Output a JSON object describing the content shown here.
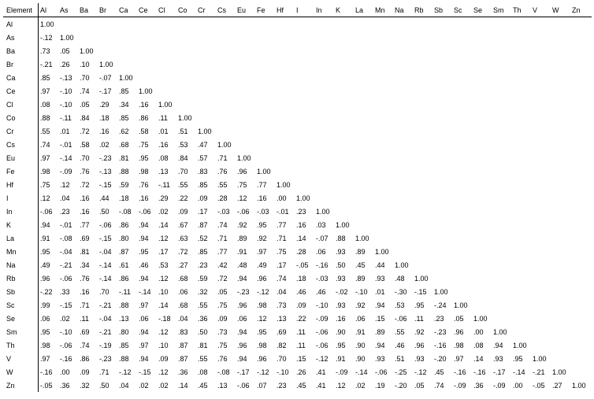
{
  "chart_data": {
    "type": "table",
    "title": "",
    "row_label": "Element",
    "elements": [
      "Al",
      "As",
      "Ba",
      "Br",
      "Ca",
      "Ce",
      "Cl",
      "Co",
      "Cr",
      "Cs",
      "Eu",
      "Fe",
      "Hf",
      "I",
      "In",
      "K",
      "La",
      "Mn",
      "Na",
      "Rb",
      "Sb",
      "Sc",
      "Se",
      "Sm",
      "Th",
      "V",
      "W",
      "Zn"
    ],
    "matrix": [
      [
        1.0
      ],
      [
        -0.12,
        1.0
      ],
      [
        0.73,
        0.05,
        1.0
      ],
      [
        -0.21,
        0.26,
        0.1,
        1.0
      ],
      [
        0.85,
        -0.13,
        0.7,
        -0.07,
        1.0
      ],
      [
        0.97,
        -0.1,
        0.74,
        -0.17,
        0.85,
        1.0
      ],
      [
        0.08,
        -0.1,
        0.05,
        0.29,
        0.34,
        0.16,
        1.0
      ],
      [
        0.88,
        -0.11,
        0.84,
        0.18,
        0.85,
        0.86,
        0.11,
        1.0
      ],
      [
        0.55,
        0.01,
        0.72,
        0.16,
        0.62,
        0.58,
        0.01,
        0.51,
        1.0
      ],
      [
        0.74,
        -0.01,
        0.58,
        0.02,
        0.68,
        0.75,
        0.16,
        0.53,
        0.47,
        1.0
      ],
      [
        0.97,
        -0.14,
        0.7,
        -0.23,
        0.81,
        0.95,
        0.08,
        0.84,
        0.57,
        0.71,
        1.0
      ],
      [
        0.98,
        -0.09,
        0.76,
        -0.13,
        0.88,
        0.98,
        0.13,
        0.7,
        0.83,
        0.76,
        0.96,
        1.0
      ],
      [
        0.75,
        0.12,
        0.72,
        -0.15,
        0.59,
        0.76,
        -0.11,
        0.55,
        0.85,
        0.55,
        0.75,
        0.77,
        1.0
      ],
      [
        0.12,
        0.04,
        0.16,
        0.44,
        0.18,
        0.16,
        0.29,
        0.22,
        0.09,
        0.28,
        0.12,
        0.16,
        0.0,
        1.0
      ],
      [
        -0.06,
        0.23,
        0.16,
        0.5,
        -0.08,
        -0.06,
        0.02,
        0.09,
        0.17,
        -0.03,
        -0.06,
        -0.03,
        -0.01,
        0.23,
        1.0
      ],
      [
        0.94,
        -0.01,
        0.77,
        -0.06,
        0.86,
        0.94,
        0.14,
        0.67,
        0.87,
        0.74,
        0.92,
        0.95,
        0.77,
        0.16,
        0.03,
        1.0
      ],
      [
        0.91,
        -0.08,
        0.69,
        -0.15,
        0.8,
        0.94,
        0.12,
        0.63,
        0.52,
        0.71,
        0.89,
        0.92,
        0.71,
        0.14,
        -0.07,
        0.88,
        1.0
      ],
      [
        0.95,
        -0.04,
        0.81,
        -0.04,
        0.87,
        0.95,
        0.17,
        0.72,
        0.85,
        0.77,
        0.91,
        0.97,
        0.75,
        0.28,
        0.06,
        0.93,
        0.89,
        1.0
      ],
      [
        0.49,
        -0.21,
        0.34,
        -0.14,
        0.61,
        0.46,
        0.53,
        0.27,
        0.23,
        0.42,
        0.48,
        0.49,
        0.17,
        -0.05,
        -0.16,
        0.5,
        0.45,
        0.44,
        1.0
      ],
      [
        0.96,
        -0.06,
        0.76,
        -0.14,
        0.86,
        0.94,
        0.12,
        0.68,
        0.59,
        0.72,
        0.94,
        0.96,
        0.74,
        0.18,
        -0.03,
        0.93,
        0.89,
        0.93,
        0.48,
        1.0
      ],
      [
        -0.22,
        0.33,
        0.16,
        0.7,
        -0.11,
        -0.14,
        0.1,
        0.06,
        0.32,
        0.05,
        -0.23,
        -0.12,
        0.04,
        0.46,
        0.46,
        -0.02,
        -0.1,
        0.01,
        -0.3,
        -0.15,
        1.0
      ],
      [
        0.99,
        -0.15,
        0.71,
        -0.21,
        0.88,
        0.97,
        0.14,
        0.68,
        0.55,
        0.75,
        0.96,
        0.98,
        0.73,
        0.09,
        -0.1,
        0.93,
        0.92,
        0.94,
        0.53,
        0.95,
        -0.24,
        1.0
      ],
      [
        0.06,
        0.02,
        0.11,
        -0.04,
        0.13,
        0.06,
        -0.18,
        0.04,
        0.36,
        0.09,
        0.06,
        0.12,
        0.13,
        0.22,
        -0.09,
        0.16,
        0.06,
        0.15,
        -0.06,
        0.11,
        0.23,
        0.05,
        1.0
      ],
      [
        0.95,
        -0.1,
        0.69,
        -0.21,
        0.8,
        0.94,
        0.12,
        0.83,
        0.5,
        0.73,
        0.94,
        0.95,
        0.69,
        0.11,
        -0.06,
        0.9,
        0.91,
        0.89,
        0.55,
        0.92,
        -0.23,
        0.96,
        0.0,
        1.0
      ],
      [
        0.98,
        -0.06,
        0.74,
        -0.19,
        0.85,
        0.97,
        0.1,
        0.87,
        0.81,
        0.75,
        0.96,
        0.98,
        0.82,
        0.11,
        -0.06,
        0.95,
        0.9,
        0.94,
        0.46,
        0.96,
        -0.16,
        0.98,
        0.08,
        0.94,
        1.0
      ],
      [
        0.97,
        -0.16,
        0.86,
        -0.23,
        0.88,
        0.94,
        0.09,
        0.87,
        0.55,
        0.76,
        0.94,
        0.96,
        0.7,
        0.15,
        -0.12,
        0.91,
        0.9,
        0.93,
        0.51,
        0.93,
        -0.2,
        0.97,
        0.14,
        0.93,
        0.95,
        1.0
      ],
      [
        -0.16,
        0.0,
        0.09,
        0.71,
        -0.12,
        -0.15,
        0.12,
        0.36,
        0.08,
        -0.08,
        -0.17,
        -0.12,
        -0.1,
        0.26,
        0.41,
        -0.09,
        -0.14,
        -0.06,
        -0.25,
        -0.12,
        0.45,
        -0.16,
        -0.16,
        -0.17,
        -0.14,
        -0.21,
        1.0
      ],
      [
        -0.05,
        0.36,
        0.32,
        0.5,
        0.04,
        0.02,
        0.02,
        0.14,
        0.45,
        0.13,
        -0.06,
        0.07,
        0.23,
        0.45,
        0.41,
        0.12,
        0.02,
        0.19,
        -0.2,
        0.05,
        0.74,
        -0.09,
        0.36,
        -0.09,
        0.0,
        -0.05,
        0.27,
        1.0
      ]
    ]
  }
}
